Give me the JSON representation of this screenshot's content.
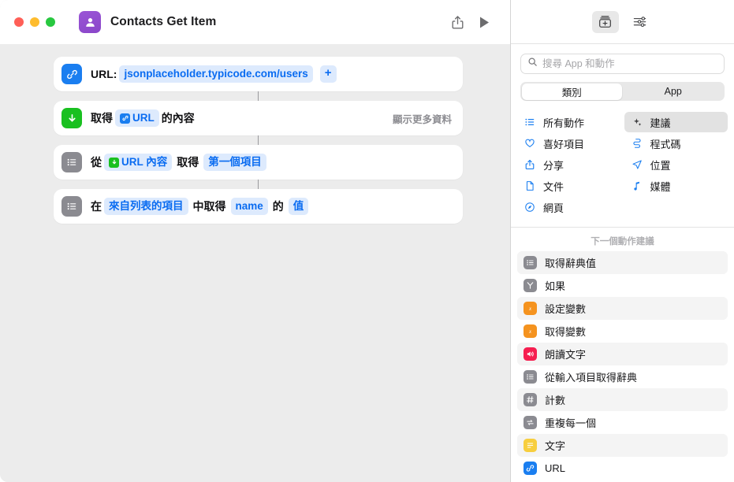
{
  "window": {
    "title": "Contacts Get Item",
    "app_icon": "contacts-icon",
    "share_icon": "share-icon",
    "run_icon": "play-icon"
  },
  "workflow": {
    "actions": [
      {
        "id": "url",
        "icon": "link-icon",
        "icon_color": "#1a7ef0",
        "label": "URL:",
        "value": "jsonplaceholder.typicode.com/users",
        "add_label": "+"
      },
      {
        "id": "get-contents-of-url",
        "icon": "download-arrow-icon",
        "icon_color": "#19c020",
        "prefix": "取得",
        "token": "URL",
        "suffix": "的內容",
        "more_label": "顯示更多資料"
      },
      {
        "id": "get-item-from-list",
        "icon": "list-icon",
        "icon_color": "#8b8b91",
        "prefix": "從",
        "token": "URL 內容",
        "mid": "取得",
        "token2": "第一個項目"
      },
      {
        "id": "get-dictionary-value",
        "icon": "list-icon",
        "icon_color": "#8b8b91",
        "prefix": "在",
        "token": "來自列表的項目",
        "mid": "中取得",
        "token2": "name",
        "mid2": "的",
        "token3": "值"
      }
    ]
  },
  "sidebar": {
    "toolbar": {
      "library_icon": "action-library-icon",
      "settings_icon": "sliders-icon"
    },
    "search": {
      "placeholder": "搜尋 App 和動作",
      "value": "",
      "icon": "search-icon"
    },
    "segmented": {
      "options": [
        {
          "label": "類別",
          "selected": true
        },
        {
          "label": "App",
          "selected": false
        }
      ]
    },
    "categories": [
      {
        "label": "所有動作",
        "icon": "list-bullets-icon",
        "selected": false
      },
      {
        "label": "建議",
        "icon": "sparkles-icon",
        "selected": true
      },
      {
        "label": "喜好項目",
        "icon": "heart-icon",
        "selected": false
      },
      {
        "label": "程式碼",
        "icon": "code-ribbon-icon",
        "selected": false
      },
      {
        "label": "分享",
        "icon": "share-icon",
        "selected": false
      },
      {
        "label": "位置",
        "icon": "location-arrow-icon",
        "selected": false
      },
      {
        "label": "文件",
        "icon": "document-icon",
        "selected": false
      },
      {
        "label": "媒體",
        "icon": "music-note-icon",
        "selected": false
      },
      {
        "label": "網頁",
        "icon": "safari-compass-icon",
        "selected": false
      }
    ],
    "suggestions_header": "下一個動作建議",
    "suggestions": [
      {
        "label": "取得辭典值",
        "icon": "list-icon",
        "color": "sc-gray"
      },
      {
        "label": "如果",
        "icon": "branch-icon",
        "color": "sc-gray"
      },
      {
        "label": "設定變數",
        "icon": "variable-icon",
        "color": "sc-orange"
      },
      {
        "label": "取得變數",
        "icon": "variable-icon",
        "color": "sc-orange"
      },
      {
        "label": "朗讀文字",
        "icon": "speaker-icon",
        "color": "sc-pink"
      },
      {
        "label": "從輸入項目取得辭典",
        "icon": "list-icon",
        "color": "sc-gray"
      },
      {
        "label": "計數",
        "icon": "hash-icon",
        "color": "sc-gray"
      },
      {
        "label": "重複每一個",
        "icon": "repeat-icon",
        "color": "sc-gray"
      },
      {
        "label": "文字",
        "icon": "text-lines-icon",
        "color": "sc-yellow"
      },
      {
        "label": "URL",
        "icon": "link-icon",
        "color": "sc-blue"
      }
    ]
  }
}
